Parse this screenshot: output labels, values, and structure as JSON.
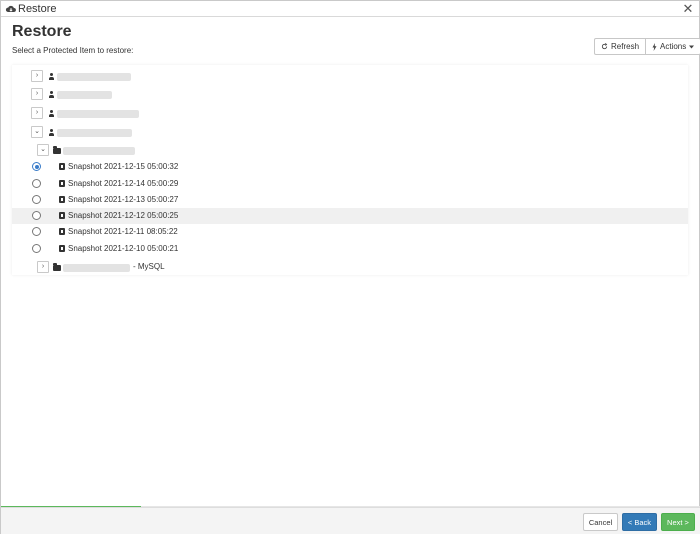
{
  "window": {
    "title": "Restore",
    "icon": "cloud-icon",
    "close_icon": "close-icon"
  },
  "page": {
    "heading": "Restore",
    "subtitle": "Select a Protected Item to restore:"
  },
  "toolbar": {
    "refresh_label": "Refresh",
    "actions_label": "Actions"
  },
  "tree": {
    "snapshots": [
      {
        "label": "Snapshot 2021-12-15 05:00:32",
        "selected": true
      },
      {
        "label": "Snapshot 2021-12-14 05:00:29",
        "selected": false
      },
      {
        "label": "Snapshot 2021-12-13 05:00:27",
        "selected": false
      },
      {
        "label": "Snapshot 2021-12-12 05:00:25",
        "selected": false
      },
      {
        "label": "Snapshot 2021-12-11 08:05:22",
        "selected": false
      },
      {
        "label": "Snapshot 2021-12-10 05:00:21",
        "selected": false
      }
    ],
    "mysql_suffix": "- MySQL"
  },
  "progress": {
    "fraction": 0.2
  },
  "footer": {
    "cancel_label": "Cancel",
    "back_label": "< Back",
    "next_label": "Next >"
  },
  "colors": {
    "primary": "#337ab7",
    "success": "#5cb85c",
    "radio_selected": "#3a7cc9"
  }
}
